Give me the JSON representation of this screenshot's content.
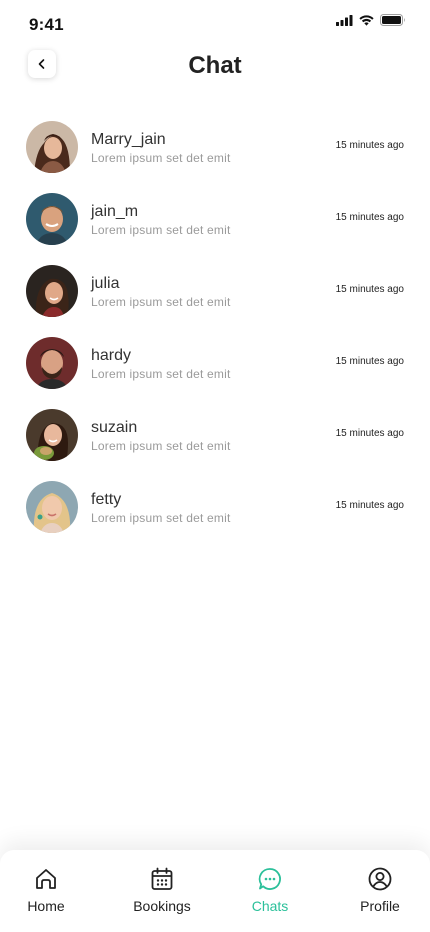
{
  "status_bar": {
    "time": "9:41",
    "icons": [
      "signal-icon",
      "wifi-icon",
      "battery-icon"
    ]
  },
  "header": {
    "title": "Chat",
    "back_icon": "chevron-left-icon"
  },
  "chats": [
    {
      "name": "Marry_jain",
      "preview": "Lorem ipsum set det emit",
      "time": "15 minutes ago"
    },
    {
      "name": "jain_m",
      "preview": "Lorem ipsum set det emit",
      "time": "15 minutes ago"
    },
    {
      "name": "julia",
      "preview": "Lorem ipsum set det emit",
      "time": "15 minutes ago"
    },
    {
      "name": "hardy",
      "preview": "Lorem ipsum set det emit",
      "time": "15 minutes ago"
    },
    {
      "name": "suzain",
      "preview": "Lorem ipsum set det emit",
      "time": "15 minutes ago"
    },
    {
      "name": "fetty",
      "preview": "Lorem ipsum set det emit",
      "time": "15 minutes ago"
    }
  ],
  "nav": {
    "items": [
      {
        "label": "Home",
        "icon": "home-icon",
        "active": false
      },
      {
        "label": "Bookings",
        "icon": "calendar-icon",
        "active": false
      },
      {
        "label": "Chats",
        "icon": "chat-bubble-icon",
        "active": true
      },
      {
        "label": "Profile",
        "icon": "user-circle-icon",
        "active": false
      }
    ],
    "active_color": "#2bc09a",
    "inactive_color": "#222222"
  }
}
